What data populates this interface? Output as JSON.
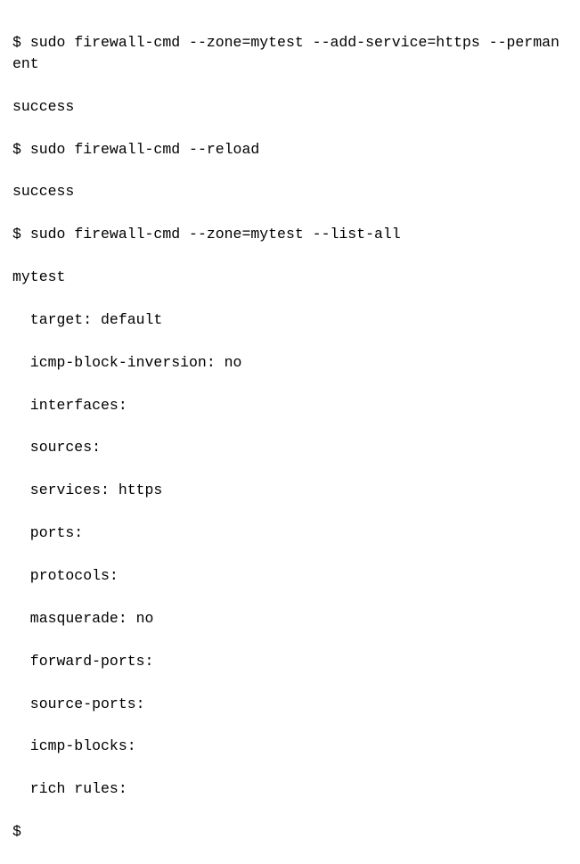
{
  "prompt": "$",
  "cmd1": "sudo firewall-cmd --zone=mytest --add-service=https --permanent",
  "out1": "success",
  "cmd2": "sudo firewall-cmd --reload",
  "out2": "success",
  "cmd3": "sudo firewall-cmd --zone=mytest --list-all",
  "zone_name": "mytest",
  "props": {
    "target": "target: default",
    "icmp_block_inversion": "icmp-block-inversion: no",
    "interfaces": "interfaces:",
    "sources": "sources:",
    "services": "services: https",
    "ports": "ports:",
    "protocols": "protocols:",
    "masquerade": "masquerade: no",
    "forward_ports": "forward-ports:",
    "source_ports": "source-ports:",
    "icmp_blocks": "icmp-blocks:",
    "rich_rules": "rich rules:"
  }
}
